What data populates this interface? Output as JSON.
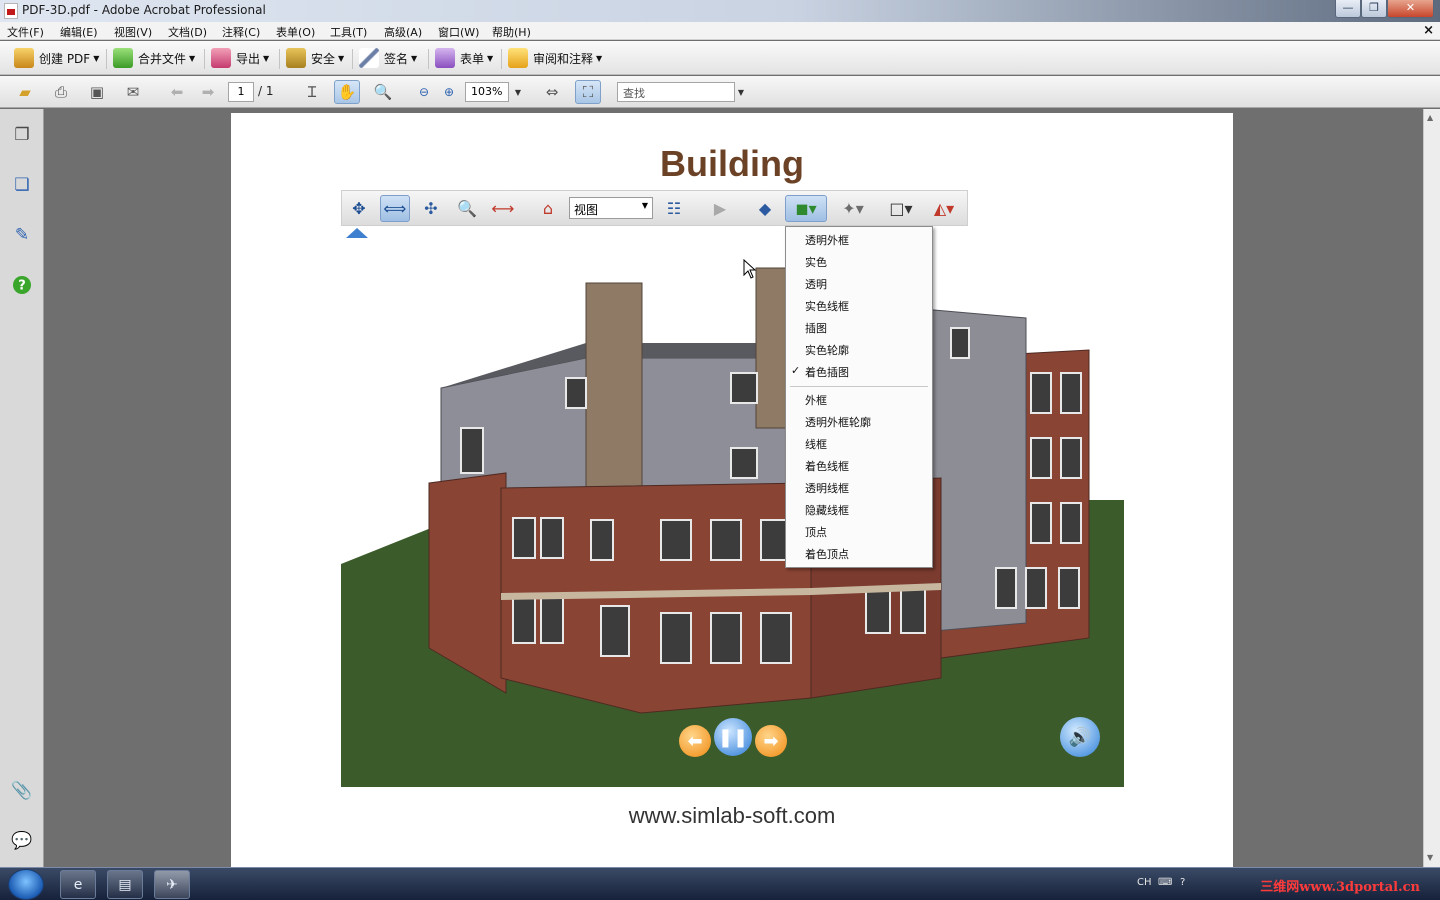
{
  "window": {
    "title": "PDF-3D.pdf - Adobe Acrobat Professional",
    "minimize": "—",
    "maximize": "❐",
    "close": "✕"
  },
  "menubar": {
    "items": [
      "文件(F)",
      "编辑(E)",
      "视图(V)",
      "文档(D)",
      "注释(C)",
      "表单(O)",
      "工具(T)",
      "高级(A)",
      "窗口(W)",
      "帮助(H)"
    ],
    "close_doc": "×"
  },
  "tasks": {
    "create_pdf": "创建 PDF",
    "combine": "合并文件",
    "export": "导出",
    "secure": "安全",
    "sign": "签名",
    "forms": "表单",
    "review": "审阅和注释"
  },
  "toolbar": {
    "page_current": "1",
    "page_total": "/ 1",
    "zoom": "103%",
    "find_placeholder": "查找"
  },
  "document": {
    "title": "Building",
    "url": "www.simlab-soft.com"
  },
  "toolbar3d": {
    "views_value": "视图"
  },
  "render_menu": {
    "group1": [
      "透明外框",
      "实色",
      "透明",
      "实色线框",
      "插图",
      "实色轮廓",
      "着色插图"
    ],
    "group2": [
      "外框",
      "透明外框轮廓",
      "线框",
      "着色线框",
      "透明线框",
      "隐藏线框",
      "顶点",
      "着色顶点"
    ],
    "checked_item": "着色插图",
    "check_mark": "✓"
  },
  "tray": {
    "lang": "CH",
    "watermark": "三维网www.3dportal.cn"
  },
  "colors": {
    "title_brown": "#6b4226",
    "ground_green": "#3b5c2a",
    "brick": "#8a4434",
    "accent_blue": "#2c5aa0"
  }
}
